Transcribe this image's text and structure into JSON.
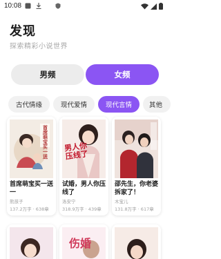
{
  "status_bar": {
    "time": "10:08"
  },
  "header": {
    "title": "发现",
    "subtitle": "探索精彩小说世界"
  },
  "gender_toggle": {
    "male_label": "男频",
    "female_label": "女频",
    "selected": "女频"
  },
  "category_tabs": [
    {
      "label": "古代情缘"
    },
    {
      "label": "现代爱情"
    },
    {
      "label": "现代言情"
    },
    {
      "label": "其他"
    }
  ],
  "active_category": "现代言情",
  "accent_color": "#8b55f3",
  "books": [
    {
      "title": "首席萌宝买一送一",
      "author": "熊孩子",
      "stats": "137.2万字 · 638章",
      "cover_text": "首席萌宝买一送"
    },
    {
      "title": "试婚，男人你压线了",
      "author": "洛安宁",
      "stats": "318.9万字 · 439章",
      "cover_text": "男人你压线了"
    },
    {
      "title": "邵先生，你老婆拆家了！",
      "author": "木宝儿",
      "stats": "131.8万字 · 617章",
      "cover_text": ""
    }
  ],
  "books_row2": [
    {
      "cover_text": ""
    },
    {
      "cover_text": "伤婚"
    },
    {
      "cover_text": ""
    }
  ]
}
